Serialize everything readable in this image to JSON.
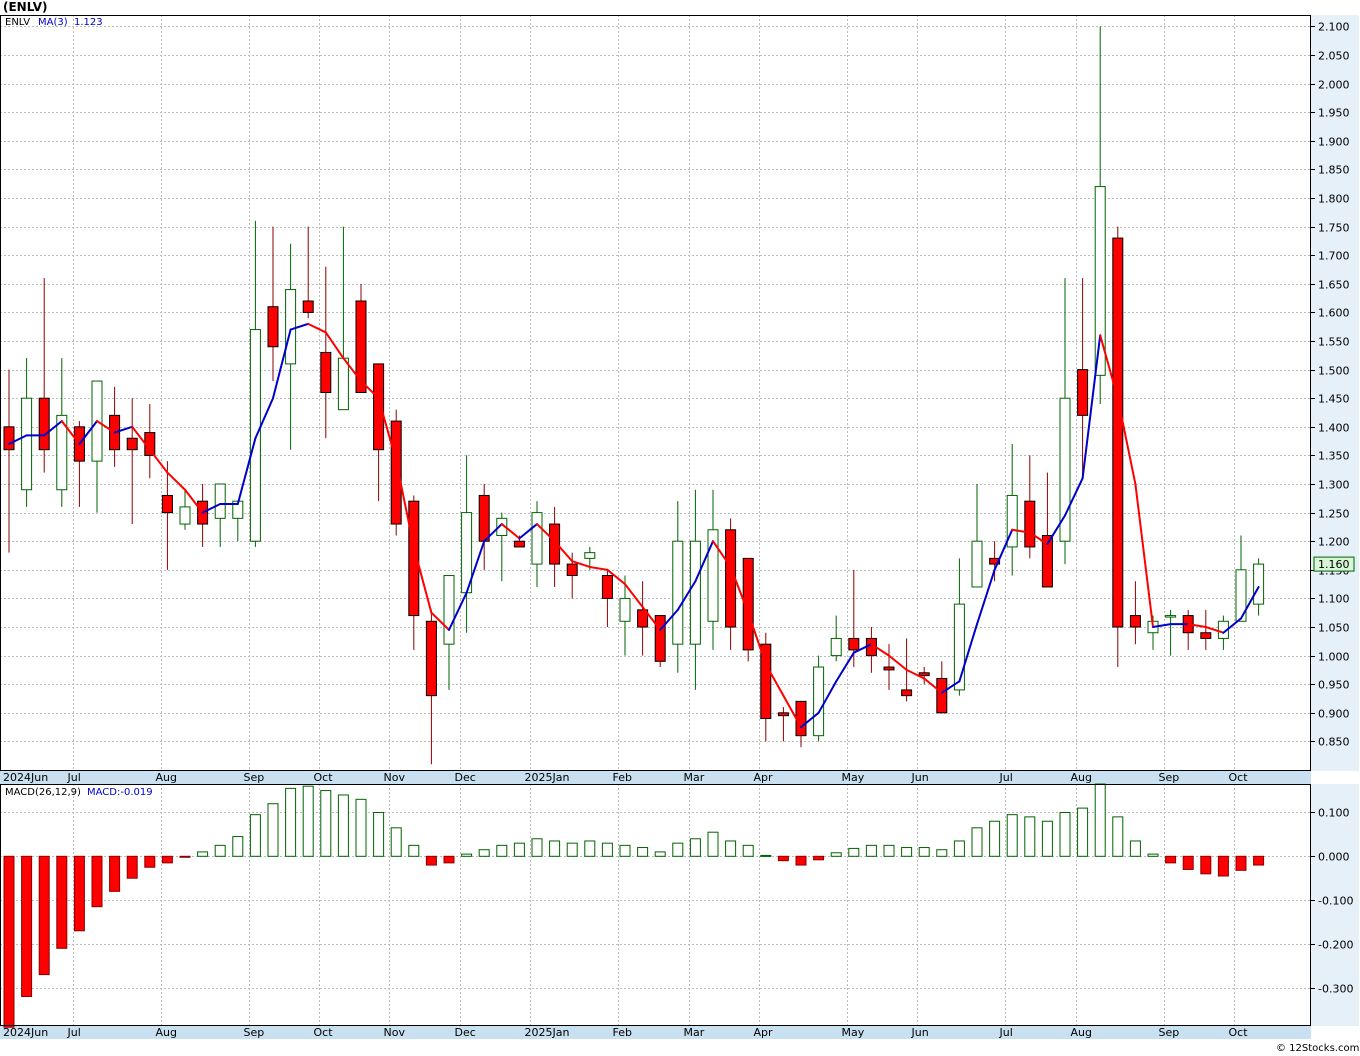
{
  "title": "(ENLV)",
  "price_legend": {
    "symbol": "ENLV",
    "ma_label": "MA(3)",
    "ma_value": "1.123"
  },
  "macd_legend": {
    "label": "MACD(26,12,9)",
    "value": "MACD:-0.019"
  },
  "last_price_label": "1.160",
  "credit": "© 12Stocks.com",
  "month_labels": [
    "2024Jun",
    "Jul",
    "Aug",
    "Sep",
    "Oct",
    "Nov",
    "Dec",
    "2025Jan",
    "Feb",
    "Mar",
    "Apr",
    "May",
    "Jun",
    "Jul",
    "Aug",
    "Sep",
    "Oct"
  ],
  "colors": {
    "up": "#006400",
    "down": "#ff0000",
    "ma_up": "#0000cc",
    "ma_down": "#ff0000",
    "grid": "#bbbbbb",
    "axis_band": "#e6f0f8",
    "date_band": "#c8e0f0"
  },
  "chart_data": {
    "type": "candlestick",
    "price_axis": {
      "ylim": [
        0.8,
        2.12
      ],
      "ticks": [
        "2.100",
        "2.050",
        "2.000",
        "1.950",
        "1.900",
        "1.850",
        "1.800",
        "1.750",
        "1.700",
        "1.650",
        "1.600",
        "1.550",
        "1.500",
        "1.450",
        "1.400",
        "1.350",
        "1.300",
        "1.250",
        "1.200",
        "1.150",
        "1.100",
        "1.050",
        "1.000",
        "0.950",
        "0.900",
        "0.850"
      ]
    },
    "macd_axis": {
      "ylim": [
        -0.385,
        0.165
      ],
      "ticks": [
        "0.100",
        "0.000",
        "-0.100",
        "-0.200",
        "-0.300"
      ]
    },
    "candles": [
      {
        "date": "2024-06-03",
        "open": 1.4,
        "high": 1.5,
        "low": 1.18,
        "close": 1.36
      },
      {
        "date": "2024-06-10",
        "open": 1.29,
        "high": 1.52,
        "low": 1.26,
        "close": 1.45
      },
      {
        "date": "2024-06-17",
        "open": 1.45,
        "high": 1.66,
        "low": 1.32,
        "close": 1.36
      },
      {
        "date": "2024-06-24",
        "open": 1.29,
        "high": 1.52,
        "low": 1.26,
        "close": 1.42
      },
      {
        "date": "2024-07-01",
        "open": 1.4,
        "high": 1.41,
        "low": 1.26,
        "close": 1.34
      },
      {
        "date": "2024-07-08",
        "open": 1.34,
        "high": 1.46,
        "low": 1.25,
        "close": 1.48
      },
      {
        "date": "2024-07-15",
        "open": 1.42,
        "high": 1.47,
        "low": 1.33,
        "close": 1.36
      },
      {
        "date": "2024-07-22",
        "open": 1.38,
        "high": 1.45,
        "low": 1.23,
        "close": 1.36
      },
      {
        "date": "2024-07-29",
        "open": 1.39,
        "high": 1.44,
        "low": 1.31,
        "close": 1.35
      },
      {
        "date": "2024-08-05",
        "open": 1.28,
        "high": 1.34,
        "low": 1.15,
        "close": 1.25
      },
      {
        "date": "2024-08-12",
        "open": 1.23,
        "high": 1.29,
        "low": 1.22,
        "close": 1.26
      },
      {
        "date": "2024-08-19",
        "open": 1.27,
        "high": 1.3,
        "low": 1.19,
        "close": 1.23
      },
      {
        "date": "2024-08-26",
        "open": 1.24,
        "high": 1.3,
        "low": 1.19,
        "close": 1.3
      },
      {
        "date": "2024-09-02",
        "open": 1.24,
        "high": 1.26,
        "low": 1.2,
        "close": 1.27
      },
      {
        "date": "2024-09-09",
        "open": 1.2,
        "high": 1.76,
        "low": 1.19,
        "close": 1.57
      },
      {
        "date": "2024-09-16",
        "open": 1.61,
        "high": 1.75,
        "low": 1.48,
        "close": 1.54
      },
      {
        "date": "2024-09-23",
        "open": 1.51,
        "high": 1.72,
        "low": 1.36,
        "close": 1.64
      },
      {
        "date": "2024-09-30",
        "open": 1.62,
        "high": 1.75,
        "low": 1.59,
        "close": 1.6
      },
      {
        "date": "2024-10-07",
        "open": 1.53,
        "high": 1.68,
        "low": 1.38,
        "close": 1.46
      },
      {
        "date": "2024-10-14",
        "open": 1.43,
        "high": 1.75,
        "low": 1.43,
        "close": 1.52
      },
      {
        "date": "2024-10-21",
        "open": 1.62,
        "high": 1.65,
        "low": 1.47,
        "close": 1.46
      },
      {
        "date": "2024-10-28",
        "open": 1.51,
        "high": 1.51,
        "low": 1.27,
        "close": 1.36
      },
      {
        "date": "2024-11-04",
        "open": 1.41,
        "high": 1.43,
        "low": 1.21,
        "close": 1.23
      },
      {
        "date": "2024-11-11",
        "open": 1.27,
        "high": 1.28,
        "low": 1.01,
        "close": 1.07
      },
      {
        "date": "2024-11-18",
        "open": 1.06,
        "high": 1.08,
        "low": 0.81,
        "close": 0.93
      },
      {
        "date": "2024-11-25",
        "open": 1.02,
        "high": 1.14,
        "low": 0.94,
        "close": 1.14
      },
      {
        "date": "2024-12-02",
        "open": 1.11,
        "high": 1.35,
        "low": 1.04,
        "close": 1.25
      },
      {
        "date": "2024-12-09",
        "open": 1.28,
        "high": 1.3,
        "low": 1.15,
        "close": 1.2
      },
      {
        "date": "2024-12-16",
        "open": 1.21,
        "high": 1.25,
        "low": 1.13,
        "close": 1.24
      },
      {
        "date": "2024-12-23",
        "open": 1.2,
        "high": 1.21,
        "low": 1.19,
        "close": 1.19
      },
      {
        "date": "2025-01-01",
        "open": 1.16,
        "high": 1.27,
        "low": 1.12,
        "close": 1.25
      },
      {
        "date": "2025-01-06",
        "open": 1.23,
        "high": 1.26,
        "low": 1.12,
        "close": 1.16
      },
      {
        "date": "2025-01-13",
        "open": 1.16,
        "high": 1.18,
        "low": 1.1,
        "close": 1.14
      },
      {
        "date": "2025-01-20",
        "open": 1.17,
        "high": 1.19,
        "low": 1.15,
        "close": 1.18
      },
      {
        "date": "2025-01-27",
        "open": 1.14,
        "high": 1.15,
        "low": 1.05,
        "close": 1.1
      },
      {
        "date": "2025-02-03",
        "open": 1.06,
        "high": 1.14,
        "low": 1.0,
        "close": 1.1
      },
      {
        "date": "2025-02-10",
        "open": 1.08,
        "high": 1.13,
        "low": 1.0,
        "close": 1.05
      },
      {
        "date": "2025-02-17",
        "open": 1.07,
        "high": 1.07,
        "low": 0.98,
        "close": 0.99
      },
      {
        "date": "2025-02-24",
        "open": 1.02,
        "high": 1.27,
        "low": 0.97,
        "close": 1.2
      },
      {
        "date": "2025-03-03",
        "open": 1.02,
        "high": 1.29,
        "low": 0.94,
        "close": 1.2
      },
      {
        "date": "2025-03-10",
        "open": 1.06,
        "high": 1.29,
        "low": 1.01,
        "close": 1.22
      },
      {
        "date": "2025-03-17",
        "open": 1.22,
        "high": 1.24,
        "low": 1.01,
        "close": 1.05
      },
      {
        "date": "2025-03-24",
        "open": 1.17,
        "high": 1.17,
        "low": 0.99,
        "close": 1.01
      },
      {
        "date": "2025-03-31",
        "open": 1.02,
        "high": 1.04,
        "low": 0.85,
        "close": 0.89
      },
      {
        "date": "2025-04-07",
        "open": 0.9,
        "high": 0.91,
        "low": 0.85,
        "close": 0.895
      },
      {
        "date": "2025-04-14",
        "open": 0.92,
        "high": 0.92,
        "low": 0.84,
        "close": 0.86
      },
      {
        "date": "2025-04-21",
        "open": 0.86,
        "high": 1.0,
        "low": 0.85,
        "close": 0.98
      },
      {
        "date": "2025-04-28",
        "open": 1.0,
        "high": 1.07,
        "low": 0.99,
        "close": 1.03
      },
      {
        "date": "2025-05-05",
        "open": 1.03,
        "high": 1.15,
        "low": 0.98,
        "close": 1.01
      },
      {
        "date": "2025-05-12",
        "open": 1.03,
        "high": 1.05,
        "low": 0.97,
        "close": 1.0
      },
      {
        "date": "2025-05-19",
        "open": 0.98,
        "high": 1.02,
        "low": 0.94,
        "close": 0.975
      },
      {
        "date": "2025-05-26",
        "open": 0.94,
        "high": 1.03,
        "low": 0.92,
        "close": 0.93
      },
      {
        "date": "2025-06-02",
        "open": 0.97,
        "high": 0.98,
        "low": 0.95,
        "close": 0.965
      },
      {
        "date": "2025-06-09",
        "open": 0.96,
        "high": 0.99,
        "low": 0.9,
        "close": 0.9
      },
      {
        "date": "2025-06-16",
        "open": 0.94,
        "high": 1.17,
        "low": 0.93,
        "close": 1.09
      },
      {
        "date": "2025-06-23",
        "open": 1.12,
        "high": 1.3,
        "low": 1.12,
        "close": 1.2
      },
      {
        "date": "2025-06-30",
        "open": 1.17,
        "high": 1.2,
        "low": 1.13,
        "close": 1.16
      },
      {
        "date": "2025-07-07",
        "open": 1.19,
        "high": 1.37,
        "low": 1.14,
        "close": 1.28
      },
      {
        "date": "2025-07-14",
        "open": 1.27,
        "high": 1.35,
        "low": 1.17,
        "close": 1.19
      },
      {
        "date": "2025-07-21",
        "open": 1.21,
        "high": 1.32,
        "low": 1.12,
        "close": 1.12
      },
      {
        "date": "2025-07-28",
        "open": 1.2,
        "high": 1.66,
        "low": 1.16,
        "close": 1.45
      },
      {
        "date": "2025-08-04",
        "open": 1.5,
        "high": 1.66,
        "low": 1.31,
        "close": 1.42
      },
      {
        "date": "2025-08-11",
        "open": 1.49,
        "high": 2.1,
        "low": 1.44,
        "close": 1.82
      },
      {
        "date": "2025-08-18",
        "open": 1.73,
        "high": 1.75,
        "low": 0.98,
        "close": 1.05
      },
      {
        "date": "2025-08-25",
        "open": 1.07,
        "high": 1.13,
        "low": 1.02,
        "close": 1.05
      },
      {
        "date": "2025-09-01",
        "open": 1.04,
        "high": 1.07,
        "low": 1.01,
        "close": 1.06
      },
      {
        "date": "2025-09-08",
        "open": 1.07,
        "high": 1.08,
        "low": 1.0,
        "close": 1.07
      },
      {
        "date": "2025-09-15",
        "open": 1.07,
        "high": 1.08,
        "low": 1.01,
        "close": 1.04
      },
      {
        "date": "2025-09-22",
        "open": 1.04,
        "high": 1.08,
        "low": 1.01,
        "close": 1.03
      },
      {
        "date": "2025-09-29",
        "open": 1.03,
        "high": 1.07,
        "low": 1.01,
        "close": 1.06
      },
      {
        "date": "2025-10-06",
        "open": 1.06,
        "high": 1.21,
        "low": 1.06,
        "close": 1.15
      },
      {
        "date": "2025-10-13",
        "open": 1.09,
        "high": 1.17,
        "low": 1.07,
        "close": 1.16
      }
    ],
    "ma3": [
      1.37,
      1.385,
      1.385,
      1.41,
      1.37,
      1.41,
      1.39,
      1.4,
      1.36,
      1.32,
      1.29,
      1.25,
      1.265,
      1.265,
      1.38,
      1.45,
      1.57,
      1.58,
      1.565,
      1.52,
      1.48,
      1.45,
      1.34,
      1.19,
      1.075,
      1.045,
      1.11,
      1.2,
      1.23,
      1.205,
      1.23,
      1.2,
      1.165,
      1.155,
      1.15,
      1.125,
      1.085,
      1.045,
      1.08,
      1.13,
      1.2,
      1.155,
      1.075,
      0.985,
      0.93,
      0.875,
      0.9,
      0.955,
      1.005,
      1.02,
      1.0,
      0.975,
      0.96,
      0.935,
      0.955,
      1.055,
      1.15,
      1.22,
      1.215,
      1.195,
      1.245,
      1.31,
      1.56,
      1.45,
      1.3,
      1.05,
      1.055,
      1.055,
      1.05,
      1.04,
      1.065,
      1.12
    ],
    "macd_hist": [
      -0.39,
      -0.32,
      -0.27,
      -0.21,
      -0.17,
      -0.115,
      -0.08,
      -0.05,
      -0.025,
      -0.015,
      -0.001,
      0.01,
      0.025,
      0.045,
      0.095,
      0.12,
      0.155,
      0.16,
      0.15,
      0.14,
      0.13,
      0.1,
      0.065,
      0.025,
      -0.02,
      -0.015,
      0.005,
      0.015,
      0.025,
      0.03,
      0.04,
      0.035,
      0.03,
      0.035,
      0.03,
      0.025,
      0.02,
      0.01,
      0.03,
      0.04,
      0.055,
      0.035,
      0.025,
      0.002,
      -0.01,
      -0.02,
      -0.008,
      0.008,
      0.018,
      0.025,
      0.025,
      0.02,
      0.02,
      0.015,
      0.035,
      0.065,
      0.08,
      0.095,
      0.09,
      0.08,
      0.1,
      0.11,
      0.165,
      0.09,
      0.035,
      0.005,
      -0.015,
      -0.03,
      -0.04,
      -0.045,
      -0.032,
      -0.02
    ]
  }
}
